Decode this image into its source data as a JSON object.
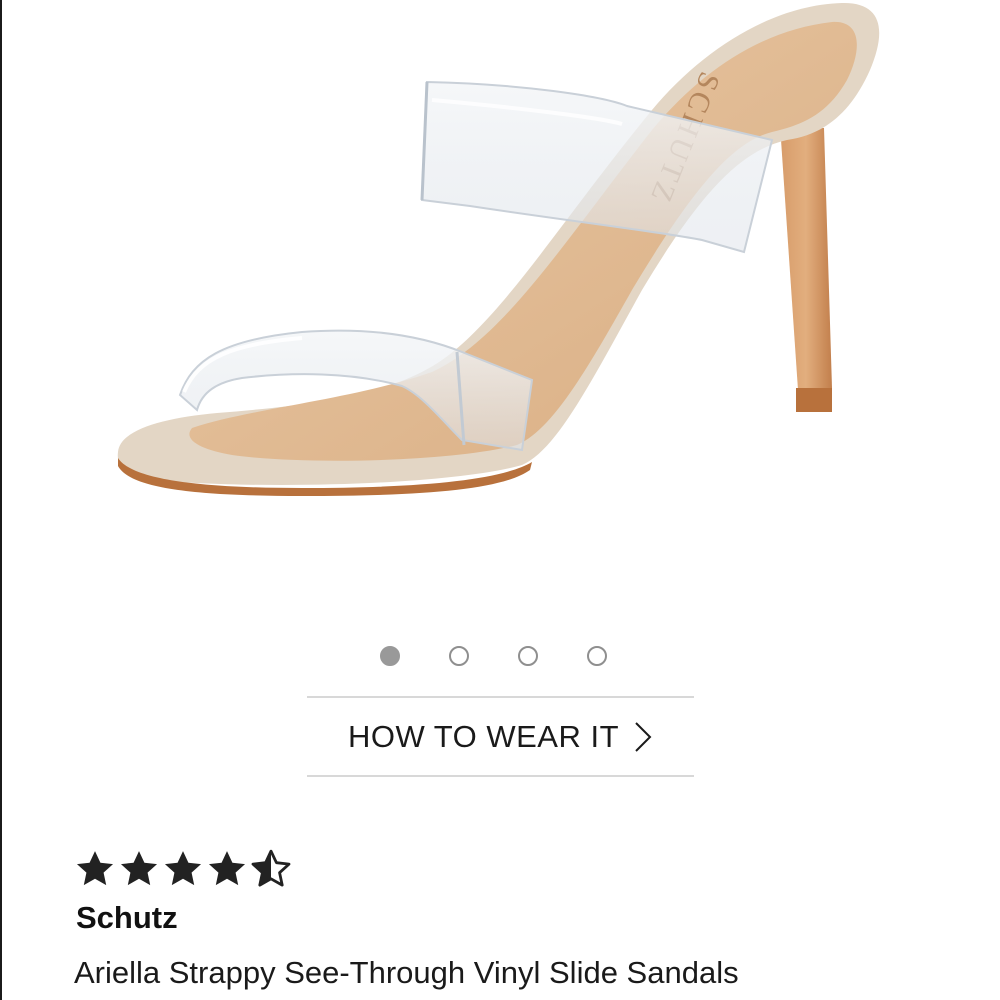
{
  "product": {
    "brand": "Schutz",
    "name": "Ariella Strappy See-Through Vinyl Slide Sandals",
    "insole_logo": "SCHUTZ",
    "rating": 4.5,
    "rating_max": 5
  },
  "carousel": {
    "total": 4,
    "active_index": 0
  },
  "how_to_wear": {
    "label": "HOW TO WEAR IT",
    "icon": "chevron-right-icon"
  },
  "colors": {
    "suede": "#e3d6c5",
    "insole": "#e2bd97",
    "heel": "#c98a57",
    "sole_edge": "#b8713c",
    "vinyl": "#eef1f4",
    "star": "#222222",
    "dot_active": "#999999",
    "divider": "#d8d8d8"
  }
}
